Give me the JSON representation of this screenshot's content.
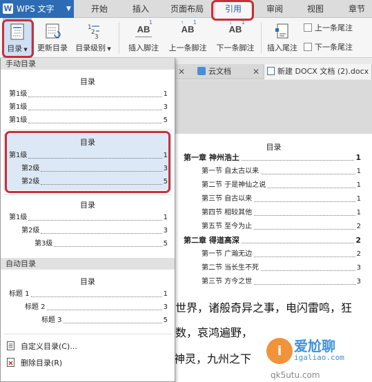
{
  "app": {
    "title": "WPS 文字"
  },
  "ribbon_tabs": [
    "开始",
    "插入",
    "页面布局",
    "引用",
    "审阅",
    "视图",
    "章节"
  ],
  "ribbon": {
    "toc_label": "目录",
    "update_toc_label": "更新目录",
    "toc_level_label": "目录级别",
    "insert_footnote_label": "插入脚注",
    "prev_footnote_label": "上一条脚注",
    "next_footnote_label": "下一条脚注",
    "insert_endnote_label": "插入尾注",
    "prev_endnote_label": "上一条尾注",
    "next_endnote_label": "下一条尾注",
    "ab_text": "AB",
    "ab1_sup": "1"
  },
  "doc_tabs": [
    {
      "label": "云文档"
    },
    {
      "label": "新建 DOCX 文档 (2).docx"
    }
  ],
  "dropdown": {
    "manual_header": "手动目录",
    "auto_header": "自动目录",
    "options": [
      {
        "title": "目录",
        "lines": [
          {
            "text": "第1级",
            "page": "1"
          },
          {
            "text": "第1级",
            "page": "3"
          },
          {
            "text": "第1级",
            "page": "5"
          }
        ]
      },
      {
        "title": "目录",
        "lines": [
          {
            "text": "第1级",
            "page": "1"
          },
          {
            "text": "第2级",
            "page": "3"
          },
          {
            "text": "第2级",
            "page": "5"
          }
        ]
      },
      {
        "title": "目录",
        "lines": [
          {
            "text": "第1级",
            "page": "1"
          },
          {
            "text": "第2级",
            "page": "3"
          },
          {
            "text": "第3级",
            "page": "5"
          }
        ]
      },
      {
        "title": "目录",
        "lines": [
          {
            "text": "标题 1",
            "page": "1"
          },
          {
            "text": "标题 2",
            "page": "3"
          },
          {
            "text": "标题 3",
            "page": "5"
          }
        ]
      }
    ],
    "custom_toc": "自定义目录(C)...",
    "delete_toc": "删除目录(R)"
  },
  "document": {
    "toc_title": "目录",
    "entries": [
      {
        "text": "第一章  神州浩土",
        "page": "1"
      },
      {
        "text": "第一节  自太古以来",
        "page": "1"
      },
      {
        "text": "第二节  于是神仙之说",
        "page": "1"
      },
      {
        "text": "第三节  自古以来",
        "page": "1"
      },
      {
        "text": "第四节  相较其他",
        "page": "1"
      },
      {
        "text": "第五节  至今为止",
        "page": "2"
      },
      {
        "text": "第二章  得道高深",
        "page": "2"
      },
      {
        "text": "第一节  广瀚无边",
        "page": "2"
      },
      {
        "text": "第二节  当长生不死",
        "page": "3"
      },
      {
        "text": "第三节  方今之世",
        "page": "3"
      }
    ],
    "body_lines": [
      "世界，诸般奇异之事，电闪雷鸣，狂",
      "数，哀鸿遍野，",
      "般神灵，九州之下"
    ]
  },
  "watermark": {
    "icon_char": "i",
    "brand": "爱尬聊",
    "url": "igaliao.com",
    "url2": "qk5utu.com"
  },
  "colors": {
    "accent_blue": "#2d6cb5",
    "highlight_red": "#c72f38",
    "hover_blue": "#dce8f5"
  }
}
